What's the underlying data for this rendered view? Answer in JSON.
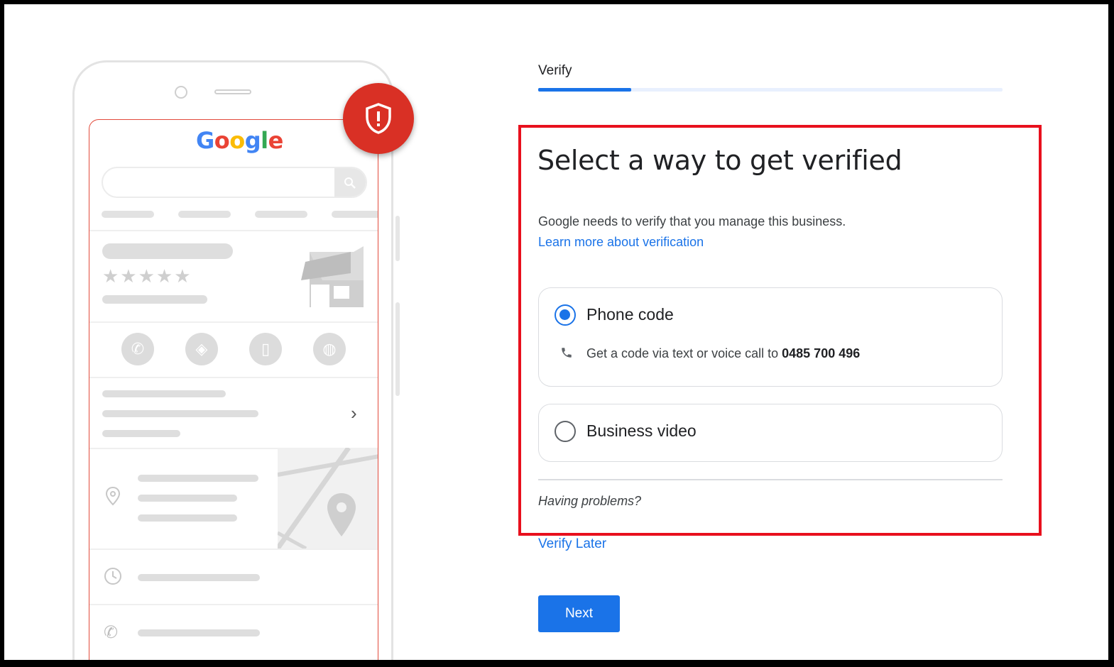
{
  "illustration": {
    "logo_letters": [
      "G",
      "o",
      "o",
      "g",
      "l",
      "e"
    ],
    "stars": "★★★★★"
  },
  "step": {
    "label": "Verify",
    "progress_fraction": 0.2
  },
  "main": {
    "title": "Select a way to get verified",
    "description": "Google needs to verify that you manage this business.",
    "learn_more": "Learn more about verification",
    "options": [
      {
        "label": "Phone code",
        "selected": true,
        "sub_prefix": "Get a code via text or voice call to ",
        "sub_number": "0485 700 496"
      },
      {
        "label": "Business video",
        "selected": false
      }
    ],
    "problems": "Having problems?"
  },
  "footer": {
    "verify_later": "Verify Later",
    "next": "Next"
  },
  "colors": {
    "accent": "#1a73e8",
    "highlight": "#e8101d",
    "shield": "#d93025"
  }
}
